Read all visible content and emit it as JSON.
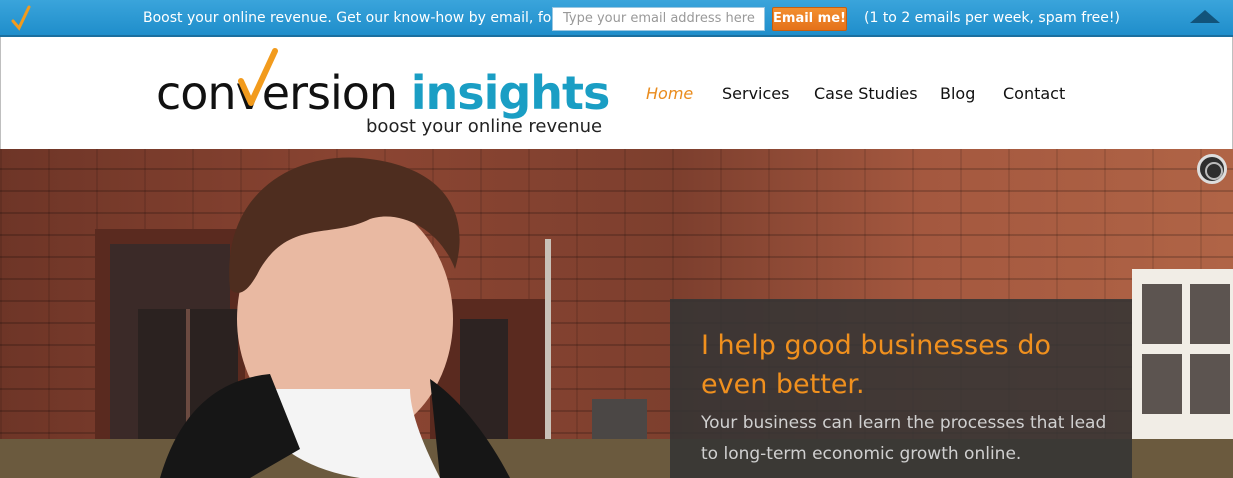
{
  "topbar": {
    "message": "Boost your online revenue. Get our know-how by email, for free.",
    "email_placeholder": "Type your email address here",
    "button_label": "Email me!",
    "note": "(1 to 2 emails per week, spam free!)"
  },
  "header": {
    "logo": {
      "word1": "conversion",
      "word2": "insights",
      "tagline": "boost your online revenue"
    },
    "nav": [
      {
        "label": "Home",
        "active": true
      },
      {
        "label": "Services",
        "active": false
      },
      {
        "label": "Case Studies",
        "active": false
      },
      {
        "label": "Blog",
        "active": false
      },
      {
        "label": "Contact",
        "active": false
      }
    ]
  },
  "hero": {
    "headline": "I help good businesses do even better.",
    "subtext": "Your business can learn the processes that lead to long-term economic growth online."
  },
  "colors": {
    "topbar_blue": "#2196d2",
    "accent_orange": "#e98b1d",
    "logo_teal": "#1a9ec4",
    "overlay": "#343434"
  },
  "icons": [
    "checkmark-icon",
    "collapse-arrow-icon",
    "slider-control-icon"
  ]
}
